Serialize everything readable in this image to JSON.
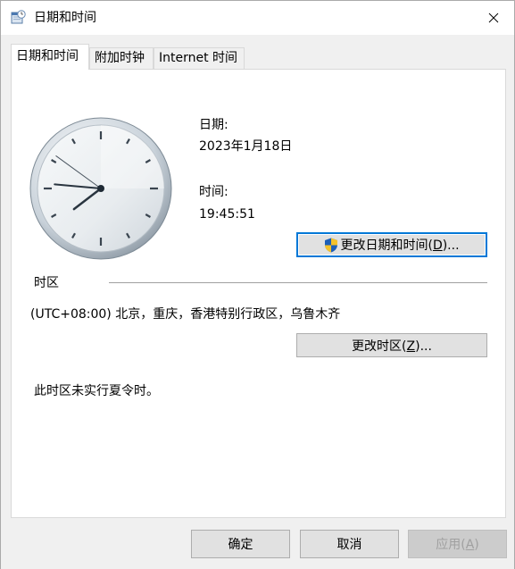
{
  "window": {
    "title": "日期和时间",
    "icon": "clock-calendar-icon"
  },
  "tabs": [
    {
      "label": "日期和时间",
      "active": true
    },
    {
      "label": "附加时钟",
      "active": false
    },
    {
      "label": "Internet 时间",
      "active": false
    }
  ],
  "datetime": {
    "date_label": "日期:",
    "date_value": "2023年1月18日",
    "time_label": "时间:",
    "time_value": "19:45:51",
    "change_button": {
      "prefix": "更改日期和时间(",
      "key": "D",
      "suffix": ")...",
      "icon": "uac-shield-icon"
    }
  },
  "timezone": {
    "section_label": "时区",
    "value": "(UTC+08:00) 北京，重庆，香港特别行政区，乌鲁木齐",
    "change_button": {
      "prefix": "更改时区(",
      "key": "Z",
      "suffix": ")..."
    },
    "dst_note": "此时区未实行夏令时。"
  },
  "footer": {
    "ok": "确定",
    "cancel": "取消",
    "apply": {
      "prefix": "应用(",
      "key": "A",
      "suffix": ")"
    }
  },
  "colors": {
    "focus_border": "#0078d7",
    "window_bg": "#f0f0f0",
    "panel_bg": "#ffffff"
  }
}
